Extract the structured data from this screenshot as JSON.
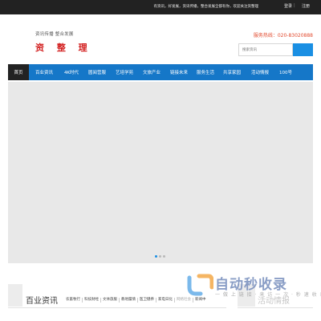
{
  "topbar": {
    "welcome": "有资讯，好发展，资讯传播，整合发展全都有你，欢迎关注资整理",
    "login": "登录",
    "separator": "|",
    "register": "注册"
  },
  "logo": {
    "slogan": "资讯传播 整合发展",
    "name": "资 整 理"
  },
  "header": {
    "hotline": "服务热线：020-83020888",
    "search_placeholder": "搜索资讯"
  },
  "nav": {
    "items": [
      {
        "label": "首页",
        "active": true
      },
      {
        "label": "百业资讯"
      },
      {
        "label": "4K时代"
      },
      {
        "label": "圆阅营服"
      },
      {
        "label": "艺培学苑"
      },
      {
        "label": "文旅产业"
      },
      {
        "label": "链接未来"
      },
      {
        "label": "服务生活"
      },
      {
        "label": "共享家园"
      },
      {
        "label": "活动情报"
      },
      {
        "label": "100号"
      }
    ]
  },
  "banner": {
    "dot_count": 3,
    "active_dot": 1
  },
  "section_news": {
    "title": "百业资讯",
    "tabs": [
      {
        "label": "农畜牧行"
      },
      {
        "label": "科技财经"
      },
      {
        "label": "文体旅服"
      },
      {
        "label": "教地履情"
      },
      {
        "label": "医卫健养"
      },
      {
        "label": "家电日化"
      },
      {
        "label": "网络社会",
        "faded": true
      },
      {
        "label": "新闻中"
      }
    ]
  },
  "section_events": {
    "title": "活动情报"
  },
  "watermark": {
    "name": "自动秒收录",
    "slogan": "一 做 上 链 接 · 来 访 一 次 · 秒 速 收 录 一"
  },
  "colors": {
    "nav_bg": "#1577c8",
    "nav_active_bg": "#222222",
    "topbar_bg": "#222222",
    "brand_red": "#d21d1d",
    "hotline": "#e24a2e",
    "search_button": "#1a8fe3"
  }
}
